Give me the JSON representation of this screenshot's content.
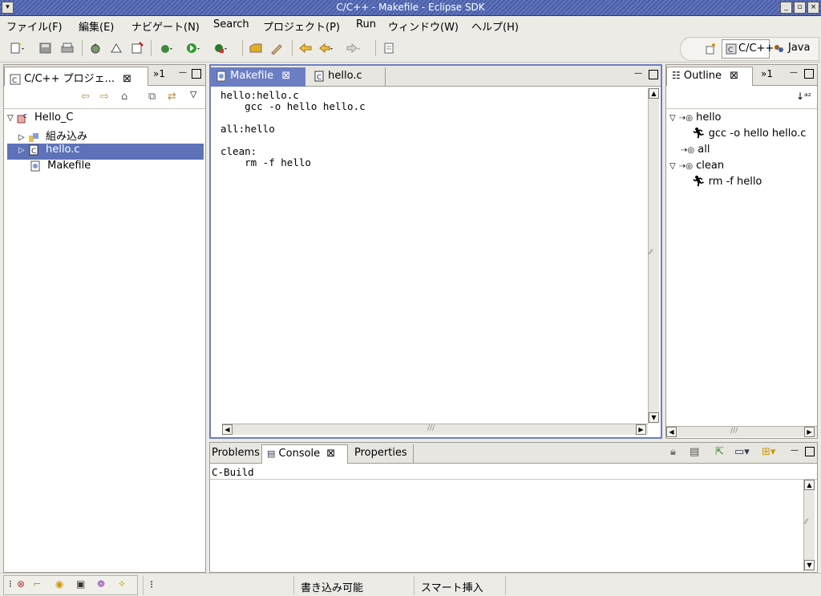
{
  "window": {
    "title": "C/C++ - Makefile - Eclipse SDK",
    "menu_icon": "chevron-down-icon",
    "controls": [
      "minimize-icon",
      "maximize-icon",
      "close-icon"
    ]
  },
  "menu": {
    "items": [
      "ファイル(F)",
      "編集(E)",
      "ナビゲート(N)",
      "Search",
      "プロジェクト(P)",
      "Run",
      "ウィンドウ(W)",
      "ヘルプ(H)"
    ]
  },
  "perspectives": {
    "cpp_label": "C/C++",
    "java_label": "Java"
  },
  "project_explorer": {
    "tab_label": "C/C++ プロジェ...",
    "overflow_label": "»1",
    "tree": [
      {
        "label": "Hello_C",
        "expanded": true,
        "level": 0,
        "icon": "c-project-icon"
      },
      {
        "label": "組み込み",
        "expanded": false,
        "level": 1,
        "icon": "includes-icon"
      },
      {
        "label": "hello.c",
        "expanded": false,
        "level": 1,
        "icon": "c-file-icon",
        "selected": true
      },
      {
        "label": "Makefile",
        "level": 1,
        "icon": "makefile-icon"
      }
    ]
  },
  "editor": {
    "tabs": [
      {
        "label": "Makefile",
        "active": true
      },
      {
        "label": "hello.c",
        "active": false
      }
    ],
    "lines": [
      "hello:hello.c",
      "    gcc -o hello hello.c",
      "",
      "all:hello",
      "",
      "clean:",
      "    rm -f hello"
    ]
  },
  "outline": {
    "tab_label": "Outline",
    "overflow_label": "»1",
    "items": [
      {
        "label": "hello",
        "level": 0,
        "type": "target",
        "expanded": true
      },
      {
        "label": "gcc -o hello hello.c",
        "level": 1,
        "type": "command"
      },
      {
        "label": "all",
        "level": 0,
        "type": "target"
      },
      {
        "label": "clean",
        "level": 0,
        "type": "target",
        "expanded": true
      },
      {
        "label": "rm -f hello",
        "level": 1,
        "type": "command"
      }
    ]
  },
  "bottom": {
    "tabs": [
      {
        "label": "Problems",
        "active": false
      },
      {
        "label": "Console",
        "active": true
      },
      {
        "label": "Properties",
        "active": false
      }
    ],
    "console_header": "C-Build"
  },
  "status": {
    "writable": "書き込み可能",
    "insert_mode": "スマート挿入"
  },
  "colors": {
    "title_bg": "#5165ad",
    "selection": "#5d72b8",
    "active_tab": "#6b7ec4"
  }
}
